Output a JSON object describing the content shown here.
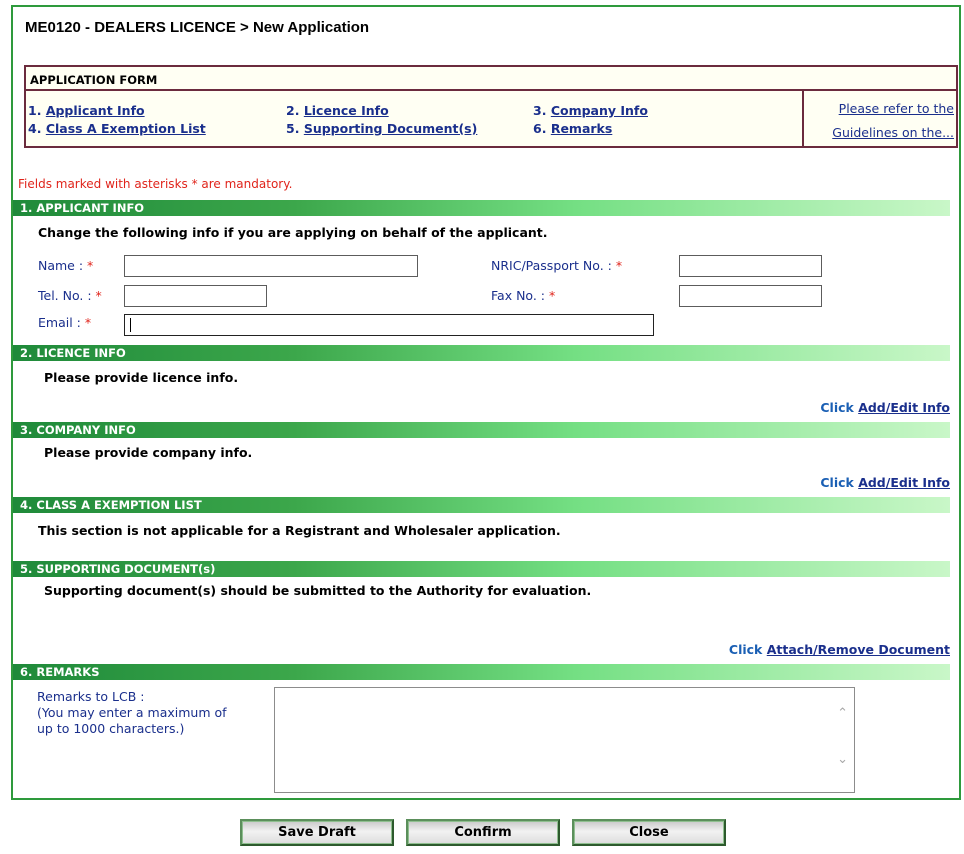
{
  "title": "ME0120 - DEALERS LICENCE > New Application",
  "app_form": {
    "heading": "APPLICATION FORM",
    "nav": [
      {
        "num": "1.",
        "label": "Applicant Info"
      },
      {
        "num": "2.",
        "label": "Licence Info"
      },
      {
        "num": "3.",
        "label": "Company Info"
      },
      {
        "num": "4.",
        "label": "Class A Exemption List"
      },
      {
        "num": "5.",
        "label": "Supporting Document(s)"
      },
      {
        "num": "6.",
        "label": "Remarks"
      }
    ],
    "ref_line1": "Please refer to the",
    "ref_line2": "Guidelines on the..."
  },
  "mandatory_note": "Fields marked with asterisks * are mandatory.",
  "sections": {
    "applicant": {
      "header": "1. APPLICANT INFO",
      "instruction": "Change the following info if you are applying on behalf of the applicant.",
      "name_label": "Name :",
      "nric_label": "NRIC/Passport No. :",
      "tel_label": "Tel. No. :",
      "fax_label": "Fax No. :",
      "email_label": "Email :",
      "asterisk": "*",
      "name_value": "",
      "nric_value": "",
      "tel_value": "",
      "fax_value": "",
      "email_value": ""
    },
    "licence": {
      "header": "2. LICENCE INFO",
      "instruction": "Please provide licence info.",
      "click": "Click",
      "link": "Add/Edit Info"
    },
    "company": {
      "header": "3. COMPANY INFO",
      "instruction": "Please provide company info.",
      "click": "Click",
      "link": "Add/Edit Info"
    },
    "exemption": {
      "header": "4. CLASS A EXEMPTION LIST",
      "instruction": "This section is not applicable for a Registrant and Wholesaler application."
    },
    "documents": {
      "header": "5. SUPPORTING DOCUMENT(s)",
      "instruction": "Supporting document(s) should be submitted to the Authority for evaluation.",
      "click": "Click",
      "link": "Attach/Remove Document"
    },
    "remarks": {
      "header": "6. REMARKS",
      "label_line1": "Remarks to LCB :",
      "label_line2": "(You may enter a maximum of",
      "label_line3": "up to 1000 characters.)",
      "value": ""
    }
  },
  "buttons": {
    "save_draft": "Save Draft",
    "confirm": "Confirm",
    "close": "Close"
  },
  "icons": {
    "scroll_up": "scroll-up-icon",
    "scroll_down": "scroll-down-icon"
  }
}
